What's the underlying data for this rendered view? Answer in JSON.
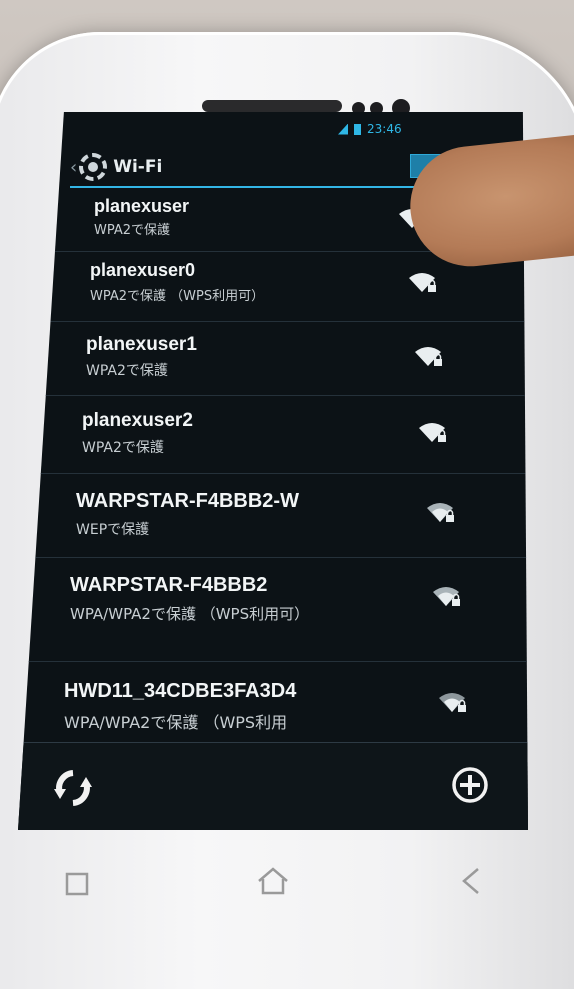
{
  "status_bar": {
    "time": "23:46"
  },
  "action_bar": {
    "title": "Wi-Fi",
    "toggle": "ON"
  },
  "networks": [
    {
      "ssid": "planexuser",
      "security": "WPA2で保護"
    },
    {
      "ssid": "planexuser0",
      "security": "WPA2で保護 （WPS利用可）"
    },
    {
      "ssid": "planexuser1",
      "security": "WPA2で保護"
    },
    {
      "ssid": "planexuser2",
      "security": "WPA2で保護"
    },
    {
      "ssid": "WARPSTAR-F4BBB2-W",
      "security": "WEPで保護"
    },
    {
      "ssid": "WARPSTAR-F4BBB2",
      "security": "WPA/WPA2で保護 （WPS利用可）"
    },
    {
      "ssid": "HWD11_34CDBE3FA3D4",
      "security": "WPA/WPA2で保護 （WPS利用"
    }
  ],
  "bottom_bar": {
    "left_icon": "scan-refresh-icon",
    "right_icon": "add-network-icon"
  },
  "hardware_keys": [
    "menu-icon",
    "home-icon",
    "back-icon"
  ],
  "colors": {
    "accent": "#33b5e5",
    "screen_bg": "#0c1216"
  }
}
